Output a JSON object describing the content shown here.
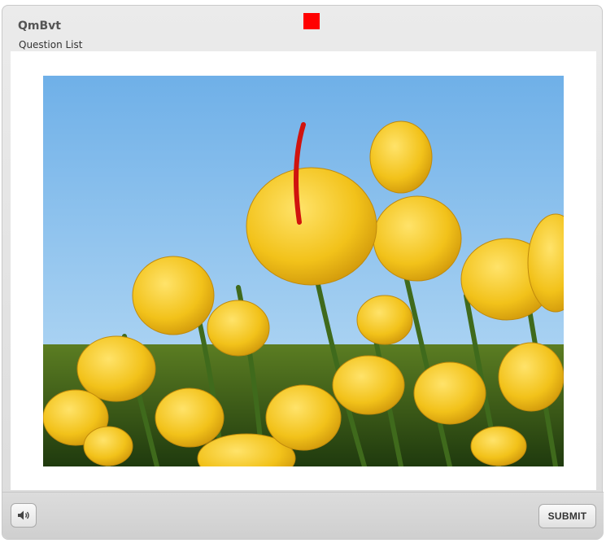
{
  "header": {
    "title": "QmBvt",
    "subtitle": "Question List",
    "marker_color": "#ff0000"
  },
  "content": {
    "image_icon": "tulips-photo",
    "sky_color": "#7fb9ea",
    "petal_color": "#f2c21a"
  },
  "footer": {
    "audio_icon": "speaker-icon",
    "submit_label": "SUBMIT"
  }
}
